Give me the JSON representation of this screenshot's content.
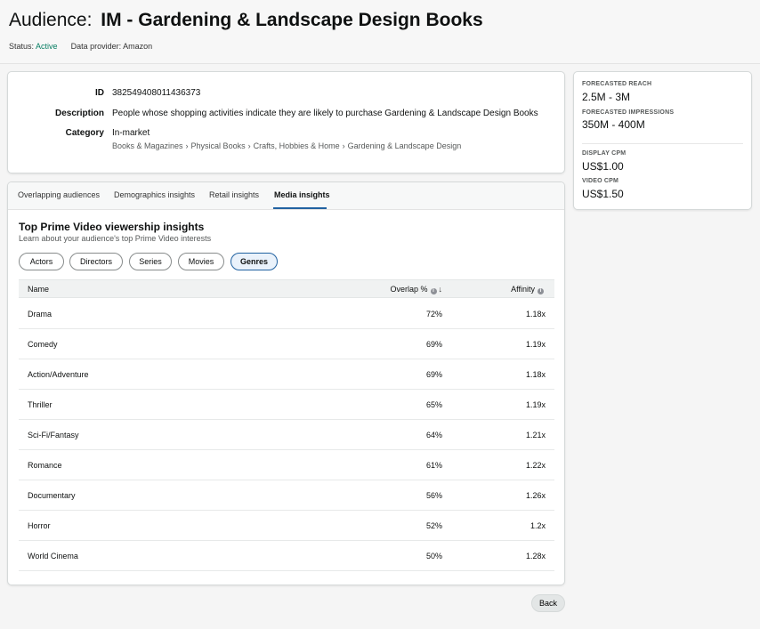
{
  "header": {
    "title_prefix": "Audience:",
    "title_main": "IM - Gardening & Landscape Design Books",
    "status_label": "Status:",
    "status_value": "Active",
    "provider_label": "Data provider:",
    "provider_value": "Amazon"
  },
  "details": {
    "id_label": "ID",
    "id_value": "382549408011436373",
    "description_label": "Description",
    "description_value": "People whose shopping activities indicate they are likely to purchase Gardening & Landscape Design Books",
    "category_label": "Category",
    "category_value": "In-market",
    "breadcrumb": [
      "Books & Magazines",
      "Physical Books",
      "Crafts, Hobbies & Home",
      "Gardening & Landscape Design"
    ],
    "breadcrumb_sep": "›"
  },
  "side": {
    "reach_label": "FORECASTED REACH",
    "reach_value": "2.5M - 3M",
    "impressions_label": "FORECASTED IMPRESSIONS",
    "impressions_value": "350M - 400M",
    "display_cpm_label": "DISPLAY CPM",
    "display_cpm_value": "US$1.00",
    "video_cpm_label": "VIDEO CPM",
    "video_cpm_value": "US$1.50"
  },
  "tabs": [
    {
      "label": "Overlapping audiences"
    },
    {
      "label": "Demographics insights"
    },
    {
      "label": "Retail insights"
    },
    {
      "label": "Media insights"
    }
  ],
  "active_tab": "Media insights",
  "media": {
    "title": "Top Prime Video viewership insights",
    "subtitle": "Learn about your audience's top Prime Video interests",
    "filters": [
      "Actors",
      "Directors",
      "Series",
      "Movies",
      "Genres"
    ],
    "active_filter": "Genres"
  },
  "table": {
    "columns": {
      "name": "Name",
      "overlap": "Overlap %",
      "affinity": "Affinity"
    },
    "rows": [
      {
        "name": "Drama",
        "overlap": "72%",
        "affinity": "1.18x"
      },
      {
        "name": "Comedy",
        "overlap": "69%",
        "affinity": "1.19x"
      },
      {
        "name": "Action/Adventure",
        "overlap": "69%",
        "affinity": "1.18x"
      },
      {
        "name": "Thriller",
        "overlap": "65%",
        "affinity": "1.19x"
      },
      {
        "name": "Sci-Fi/Fantasy",
        "overlap": "64%",
        "affinity": "1.21x"
      },
      {
        "name": "Romance",
        "overlap": "61%",
        "affinity": "1.22x"
      },
      {
        "name": "Documentary",
        "overlap": "56%",
        "affinity": "1.26x"
      },
      {
        "name": "Horror",
        "overlap": "52%",
        "affinity": "1.2x"
      },
      {
        "name": "World Cinema",
        "overlap": "50%",
        "affinity": "1.28x"
      }
    ]
  },
  "footer": {
    "back_label": "Back"
  },
  "icons": {
    "info": "info-icon",
    "sort": "sort-down-arrow-icon"
  },
  "colors": {
    "active_status": "#067d62",
    "accent": "#2162a1"
  }
}
